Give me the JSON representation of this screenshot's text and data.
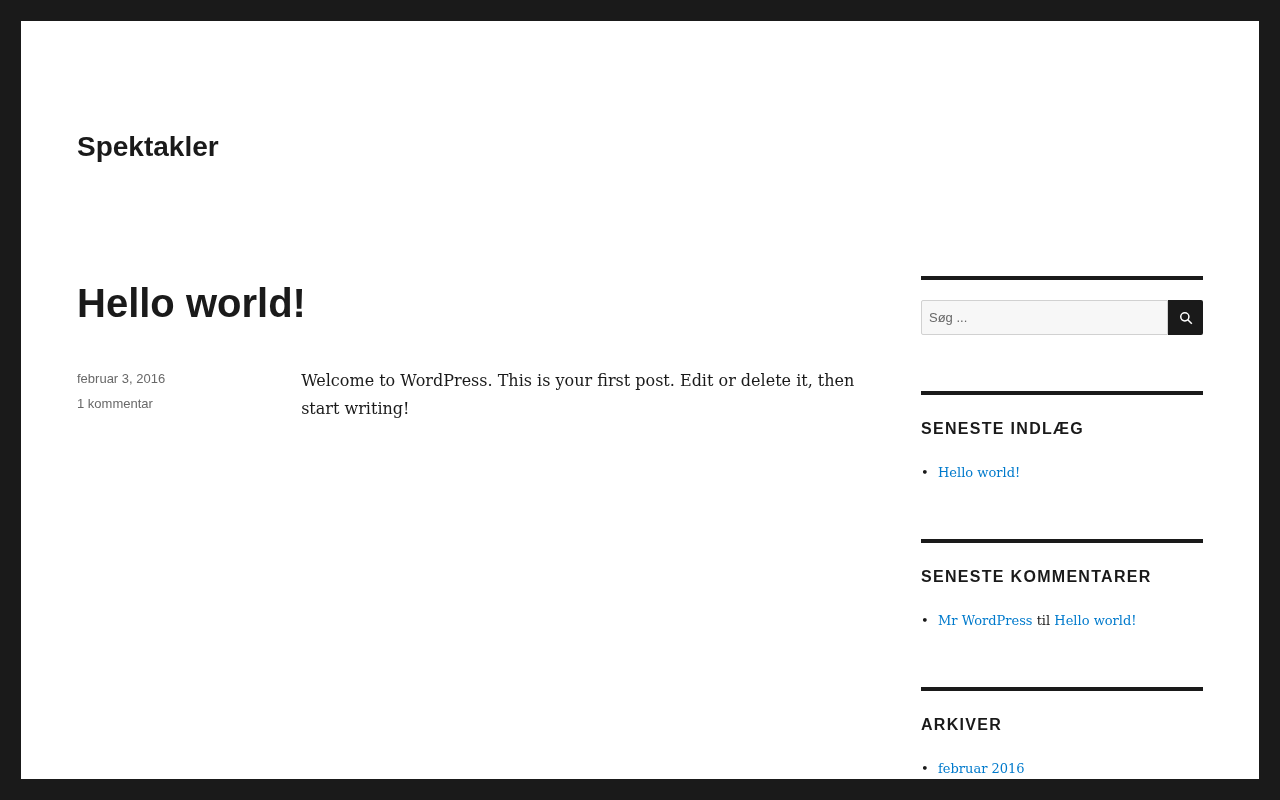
{
  "site": {
    "title": "Spektakler"
  },
  "post": {
    "title": "Hello world!",
    "date": "februar 3, 2016",
    "comments": "1 kommentar",
    "body": "Welcome to WordPress. This is your first post. Edit or delete it, then start writing!"
  },
  "widgets": [
    {
      "kind": "search",
      "placeholder": "Søg ..."
    },
    {
      "kind": "list",
      "title": "SENESTE INDLÆG",
      "items": [
        {
          "bullet": "•",
          "parts": [
            {
              "kind": "link",
              "text": "Hello world!"
            }
          ]
        }
      ]
    },
    {
      "kind": "list",
      "title": "SENESTE KOMMENTARER",
      "items": [
        {
          "bullet": "•",
          "parts": [
            {
              "kind": "link",
              "text": "Mr WordPress"
            },
            {
              "kind": "plain",
              "text": "til"
            },
            {
              "kind": "link",
              "text": "Hello world!"
            }
          ]
        }
      ]
    },
    {
      "kind": "list",
      "title": "ARKIVER",
      "items": [
        {
          "bullet": "•",
          "parts": [
            {
              "kind": "link",
              "text": "februar 2016"
            }
          ]
        }
      ]
    }
  ]
}
